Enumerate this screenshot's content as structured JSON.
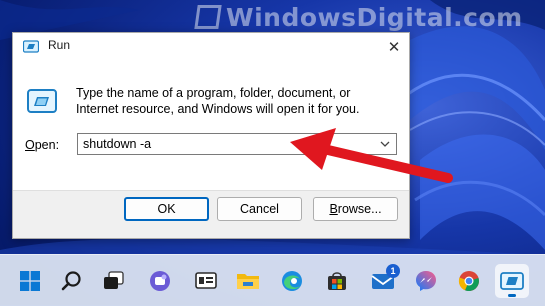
{
  "watermark": {
    "text": "WindowsDigital.com"
  },
  "dialog": {
    "title": "Run",
    "close_glyph": "✕",
    "description": "Type the name of a program, folder, document, or Internet resource, and Windows will open it for you.",
    "open_label_hotkey": "O",
    "open_label_rest": "pen:",
    "open_value": "shutdown -a",
    "ok_label": "OK",
    "cancel_label": "Cancel",
    "browse_label_hotkey": "B",
    "browse_label_rest": "rowse..."
  },
  "colors": {
    "accent": "#0067c0",
    "annotation_arrow": "#e0171f",
    "dialog_footer": "#f0f0f0"
  },
  "taskbar": {
    "items": [
      {
        "name": "start",
        "icon": "windows-logo-icon"
      },
      {
        "name": "search",
        "icon": "search-icon"
      },
      {
        "name": "task-view",
        "icon": "task-view-icon"
      },
      {
        "name": "chat",
        "icon": "chat-icon"
      },
      {
        "name": "widgets",
        "icon": "widgets-icon"
      },
      {
        "name": "file-explorer",
        "icon": "folder-icon"
      },
      {
        "name": "edge",
        "icon": "edge-icon"
      },
      {
        "name": "store",
        "icon": "store-icon"
      },
      {
        "name": "mail",
        "icon": "mail-icon",
        "badge": "1"
      },
      {
        "name": "messenger",
        "icon": "messenger-icon"
      },
      {
        "name": "chrome",
        "icon": "chrome-icon"
      },
      {
        "name": "run",
        "icon": "run-icon",
        "active": true
      }
    ]
  }
}
